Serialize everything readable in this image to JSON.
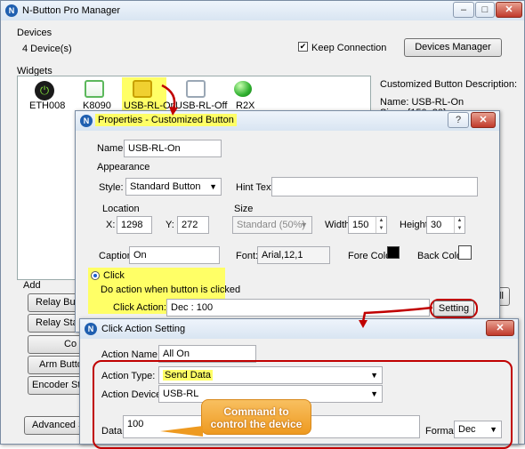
{
  "main": {
    "title": "N-Button Pro Manager",
    "devices_label": "Devices",
    "device_count": "4 Device(s)",
    "keep_connection": "Keep Connection",
    "devices_manager_button": "Devices Manager",
    "widgets_label": "Widgets",
    "widgets": [
      {
        "label": "ETH008",
        "icon": "power-icon",
        "color": "#1a1a1a"
      },
      {
        "label": "K8090",
        "icon": "button-icon",
        "color": "#5cb85c"
      },
      {
        "label": "USB-RL-On",
        "icon": "button-icon",
        "color": "#f0d030"
      },
      {
        "label": "USB-RL-Off",
        "icon": "button-icon",
        "color": "#ffffff"
      },
      {
        "label": "R2X",
        "icon": "green-ball-icon",
        "color": "#33c033"
      }
    ],
    "description_label": "Customized Button Description:",
    "description_name": "Name: USB-RL-On",
    "description_size": "Size : {150, 30}",
    "add_label": "Add",
    "add_buttons": [
      "Relay Button",
      "Relay Status",
      "Co",
      "Arm Button",
      "Encoder Status"
    ],
    "advanced_button": "Advanced Se"
  },
  "properties": {
    "title": "Properties - Customized Button",
    "name_label": "Name:",
    "name_value": "USB-RL-On",
    "appearance_label": "Appearance",
    "style_label": "Style:",
    "style_value": "Standard Button",
    "hint_label": "Hint Text:",
    "location_label": "Location",
    "x_label": "X:",
    "x_value": "1298",
    "y_label": "Y:",
    "y_value": "272",
    "size_label": "Size",
    "size_value": "Standard   (50%)",
    "width_label": "Width:",
    "width_value": "150",
    "height_label": "Height:",
    "height_value": "30",
    "caption_label": "Caption:",
    "caption_value": "On",
    "font_label": "Font:",
    "font_value": "Arial,12,1",
    "fore_color_label": "Fore Color:",
    "back_color_label": "Back Color:",
    "click_label": "Click",
    "click_desc": "Do action when button is clicked",
    "click_action_label": "Click Action:",
    "click_action_value": "Dec : 100",
    "setting_button": "Setting",
    "help_glyph": "?"
  },
  "click_action": {
    "title": "Click Action Setting",
    "action_name_label": "Action Name:",
    "action_name_value": "All On",
    "action_type_label": "Action Type:",
    "action_type_value": "Send Data",
    "action_device_label": "Action Device:",
    "action_device_value": "USB-RL",
    "data_label": "Data:",
    "data_value": "100",
    "format_label": "Format:",
    "format_value": "Dec",
    "callout": "Command to control the device"
  },
  "colors": {
    "highlight": "#ffff66",
    "annotation_red": "#c00000",
    "callout_orange": "#f5a623"
  }
}
